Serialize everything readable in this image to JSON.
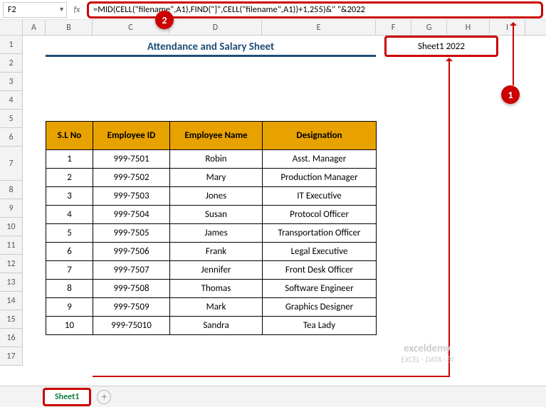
{
  "namebox": {
    "cell_ref": "F2"
  },
  "formula_bar": {
    "formula": "=MID(CELL(\"filename\",A1),FIND(\"]\",CELL(\"filename\",A1))+1,255)&\" \"&2022"
  },
  "columns": [
    "A",
    "B",
    "C",
    "D",
    "E",
    "F",
    "G",
    "H",
    "I"
  ],
  "rows": [
    "1",
    "2",
    "3",
    "4",
    "5",
    "6",
    "7",
    "8",
    "9",
    "10",
    "11",
    "12",
    "13",
    "14",
    "15",
    "16",
    "17"
  ],
  "title": "Attendance and Salary Sheet",
  "f2_value": "Sheet1 2022",
  "table": {
    "headers": [
      "S.L No",
      "Employee ID",
      "Employee Name",
      "Designation"
    ],
    "rows": [
      [
        "1",
        "999-7501",
        "Robin",
        "Asst. Manager"
      ],
      [
        "2",
        "999-7502",
        "Mary",
        "Production Manager"
      ],
      [
        "3",
        "999-7503",
        "Jones",
        "IT Executive"
      ],
      [
        "4",
        "999-7504",
        "Susan",
        "Protocol Officer"
      ],
      [
        "5",
        "999-7505",
        "James",
        "Transportation Officer"
      ],
      [
        "6",
        "999-7506",
        "Frank",
        "Legal Executive"
      ],
      [
        "7",
        "999-7507",
        "Jennifer",
        "Front Desk Officer"
      ],
      [
        "8",
        "999-7508",
        "Thomas",
        "Software Engineer"
      ],
      [
        "9",
        "999-7509",
        "Mark",
        "Graphics Designer"
      ],
      [
        "10",
        "999-75010",
        "Sandra",
        "Tea Lady"
      ]
    ]
  },
  "sheet_tab": "Sheet1",
  "callouts": {
    "one": "1",
    "two": "2"
  },
  "watermark": {
    "brand": "exceldemy",
    "tagline": "EXCEL · DATA · BI"
  },
  "chart_data": {
    "type": "table",
    "title": "Attendance and Salary Sheet",
    "columns": [
      "S.L No",
      "Employee ID",
      "Employee Name",
      "Designation"
    ],
    "rows": [
      [
        1,
        "999-7501",
        "Robin",
        "Asst. Manager"
      ],
      [
        2,
        "999-7502",
        "Mary",
        "Production Manager"
      ],
      [
        3,
        "999-7503",
        "Jones",
        "IT Executive"
      ],
      [
        4,
        "999-7504",
        "Susan",
        "Protocol Officer"
      ],
      [
        5,
        "999-7505",
        "James",
        "Transportation Officer"
      ],
      [
        6,
        "999-7506",
        "Frank",
        "Legal Executive"
      ],
      [
        7,
        "999-7507",
        "Jennifer",
        "Front Desk Officer"
      ],
      [
        8,
        "999-7508",
        "Thomas",
        "Software Engineer"
      ],
      [
        9,
        "999-7509",
        "Mark",
        "Graphics Designer"
      ],
      [
        10,
        "999-75010",
        "Sandra",
        "Tea Lady"
      ]
    ]
  }
}
